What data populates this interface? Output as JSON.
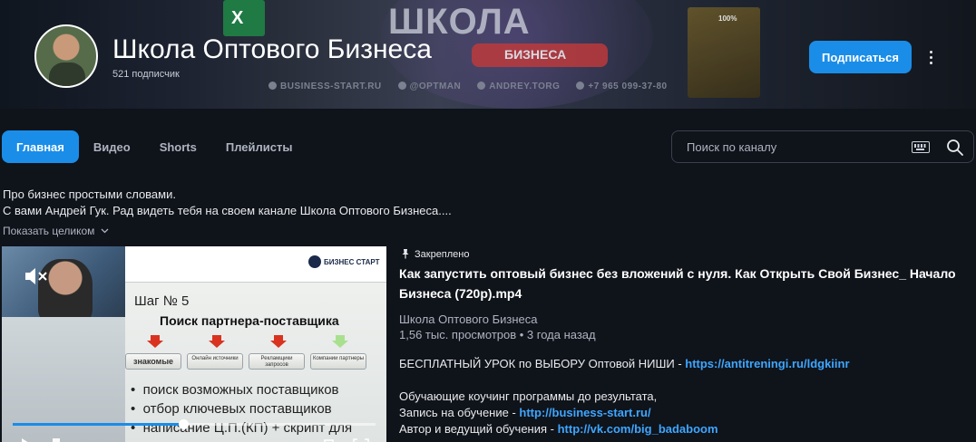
{
  "banner": {
    "app_icon_letter": "X",
    "headline": "ШКОЛА",
    "pill_text": "БИЗНЕСА",
    "book_text": "100%",
    "contacts": [
      "BUSINESS-START.RU",
      "@OPTMAN",
      "ANDREY.TORG",
      "+7 965 099-37-80"
    ]
  },
  "channel": {
    "name": "Школа Оптового Бизнеса",
    "subscribers": "521 подписчик",
    "subscribe_label": "Подписаться"
  },
  "tabs": [
    {
      "label": "Главная",
      "active": true
    },
    {
      "label": "Видео",
      "active": false
    },
    {
      "label": "Shorts",
      "active": false
    },
    {
      "label": "Плейлисты",
      "active": false
    }
  ],
  "search": {
    "placeholder": "Поиск по каналу"
  },
  "about": {
    "line1": "Про бизнес простыми словами.",
    "line2": "С вами Андрей Гук. Рад видеть тебя на своем канале Школа Оптового Бизнеса....",
    "show_more": "Показать целиком"
  },
  "player": {
    "progress_percent": 47,
    "slide": {
      "logo": "БИЗНЕС СТАРТ",
      "step": "Шаг № 5",
      "heading": "Поиск партнера-поставщика",
      "boxes": [
        "знакомые",
        "Онлайн источники",
        "Рекламщики запросов",
        "Компании партнеры"
      ],
      "bullets": [
        "поиск возможных поставщиков",
        "отбор ключевых поставщиков",
        "написание Ц.П.(КП) + скрипт для"
      ]
    }
  },
  "video": {
    "pinned_label": "Закреплено",
    "title": "Как запустить оптовый бизнес без вложений с нуля. Как Открыть Свой Бизнес_ Начало Бизнеса (720p).mp4",
    "channel": "Школа Оптового Бизнеса",
    "meta": "1,56 тыс. просмотров • 3 года назад",
    "desc1_text": "БЕСПЛАТНЫЙ УРОК по ВЫБОРУ Оптовой НИШИ - ",
    "desc1_link": "https://antitreningi.ru/ldgkiinr",
    "desc2_text": "Обучающие коучинг программы до результата,",
    "desc3_text": "Запись на обучение - ",
    "desc3_link": "http://business-start.ru/",
    "desc4_text": "Автор и ведущий обучения - ",
    "desc4_link": "http://vk.com/big_badaboom"
  },
  "colors": {
    "accent": "#1a8de8",
    "link": "#3ea6ff",
    "background": "#0f131a"
  }
}
